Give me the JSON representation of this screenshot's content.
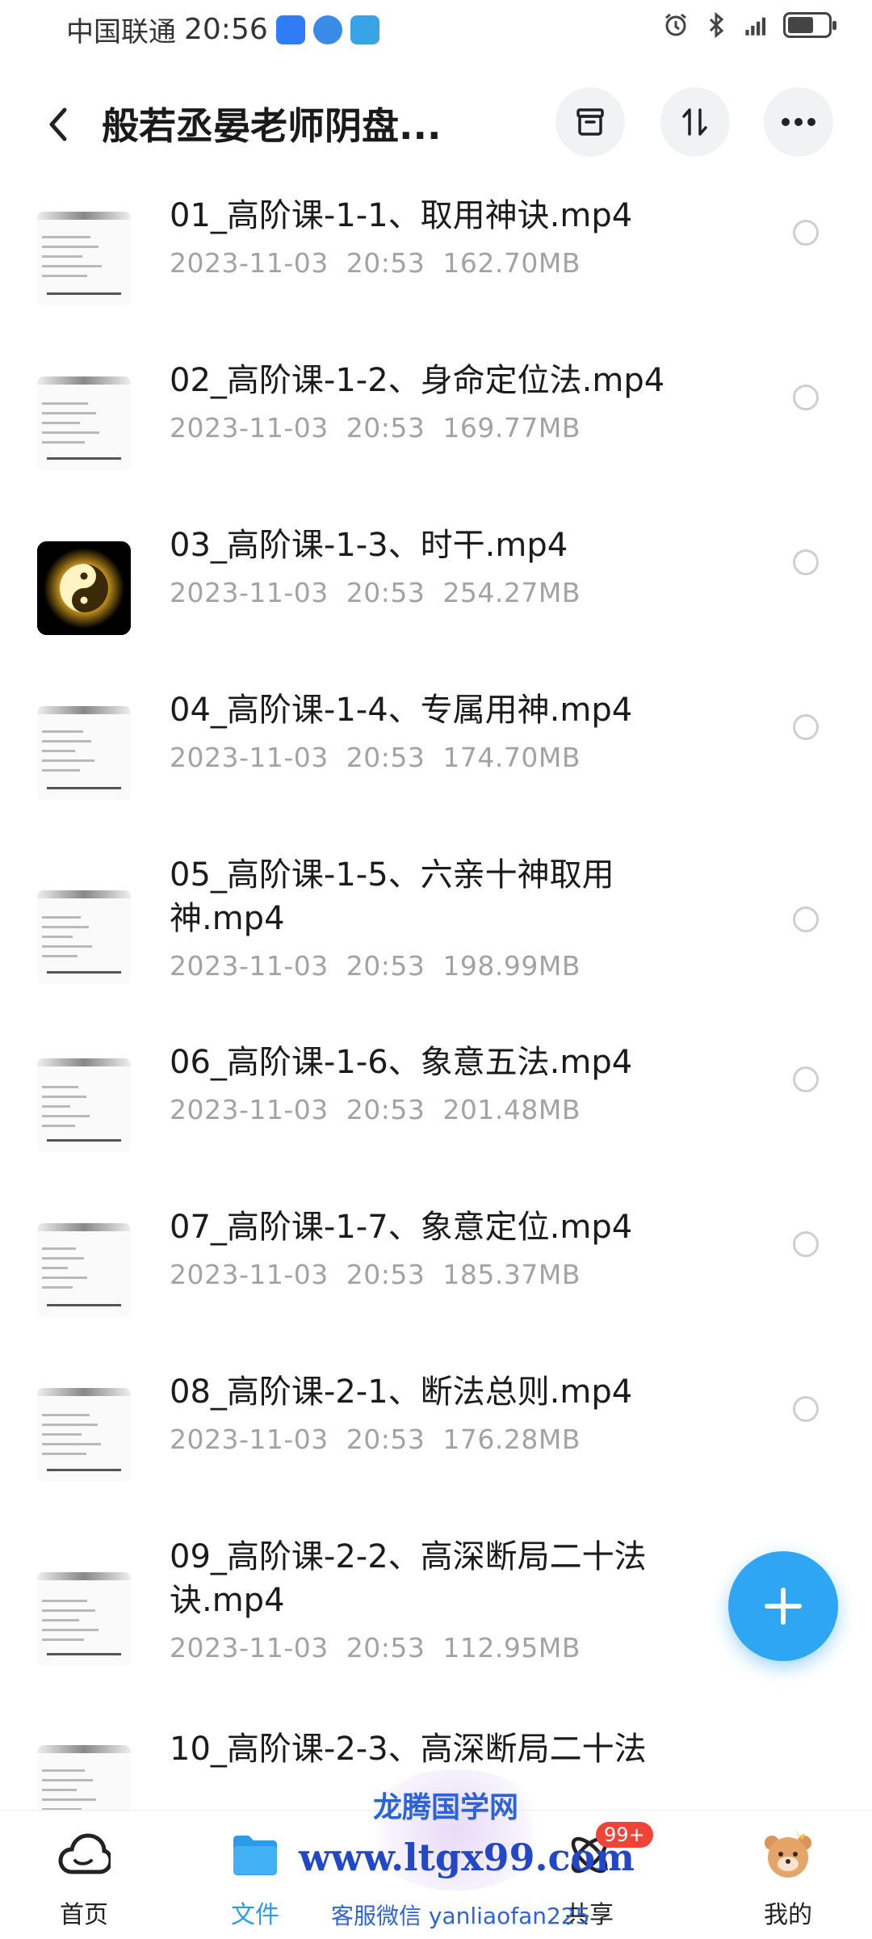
{
  "status_bar": {
    "carrier": "中国联通",
    "time": "20:56",
    "battery_level": 0.65
  },
  "header": {
    "title": "般若丞晏老师阴盘...",
    "back_icon": "chevron-left-icon",
    "actions": [
      {
        "name": "archive-button",
        "icon": "archive-icon"
      },
      {
        "name": "sort-button",
        "icon": "sort-icon"
      },
      {
        "name": "more-button",
        "icon": "more-icon"
      }
    ]
  },
  "files": [
    {
      "name": "01_高阶课-1-1、取用神诀.mp4",
      "date": "2023-11-03",
      "time": "20:53",
      "size": "162.70MB",
      "thumb": "doc"
    },
    {
      "name": "02_高阶课-1-2、身命定位法.mp4",
      "date": "2023-11-03",
      "time": "20:53",
      "size": "169.77MB",
      "thumb": "doc"
    },
    {
      "name": "03_高阶课-1-3、时干.mp4",
      "date": "2023-11-03",
      "time": "20:53",
      "size": "254.27MB",
      "thumb": "yinyang"
    },
    {
      "name": "04_高阶课-1-4、专属用神.mp4",
      "date": "2023-11-03",
      "time": "20:53",
      "size": "174.70MB",
      "thumb": "doc"
    },
    {
      "name": "05_高阶课-1-5、六亲十神取用神.mp4",
      "date": "2023-11-03",
      "time": "20:53",
      "size": "198.99MB",
      "thumb": "doc"
    },
    {
      "name": "06_高阶课-1-6、象意五法.mp4",
      "date": "2023-11-03",
      "time": "20:53",
      "size": "201.48MB",
      "thumb": "doc"
    },
    {
      "name": "07_高阶课-1-7、象意定位.mp4",
      "date": "2023-11-03",
      "time": "20:53",
      "size": "185.37MB",
      "thumb": "doc"
    },
    {
      "name": "08_高阶课-2-1、断法总则.mp4",
      "date": "2023-11-03",
      "time": "20:53",
      "size": "176.28MB",
      "thumb": "doc"
    },
    {
      "name": "09_高阶课-2-2、高深断局二十法诀.mp4",
      "date": "2023-11-03",
      "time": "20:53",
      "size": "112.95MB",
      "thumb": "doc"
    },
    {
      "name": "10_高阶课-2-3、高深断局二十法",
      "date": "",
      "time": "",
      "size": "",
      "thumb": "doc"
    }
  ],
  "fab": {
    "icon": "plus-icon"
  },
  "bottom_nav": [
    {
      "label": "首页",
      "icon": "cloud-home-icon",
      "active": false
    },
    {
      "label": "文件",
      "icon": "folder-icon",
      "active": true
    },
    {
      "label": "",
      "icon": "mascot-icon",
      "active": false
    },
    {
      "label": "共享",
      "icon": "share-orbit-icon",
      "active": false,
      "badge": "99+"
    },
    {
      "label": "我的",
      "icon": "bear-avatar-icon",
      "active": false
    }
  ],
  "watermark": {
    "title": "龙腾国学网",
    "url": "www.ltgx99.com",
    "sub": "客服微信 yanliaofan225"
  },
  "colors": {
    "accent": "#2c9be8",
    "fab": "#2ea6f4",
    "badge": "#f04438",
    "meta_text": "#a3a3a3"
  }
}
